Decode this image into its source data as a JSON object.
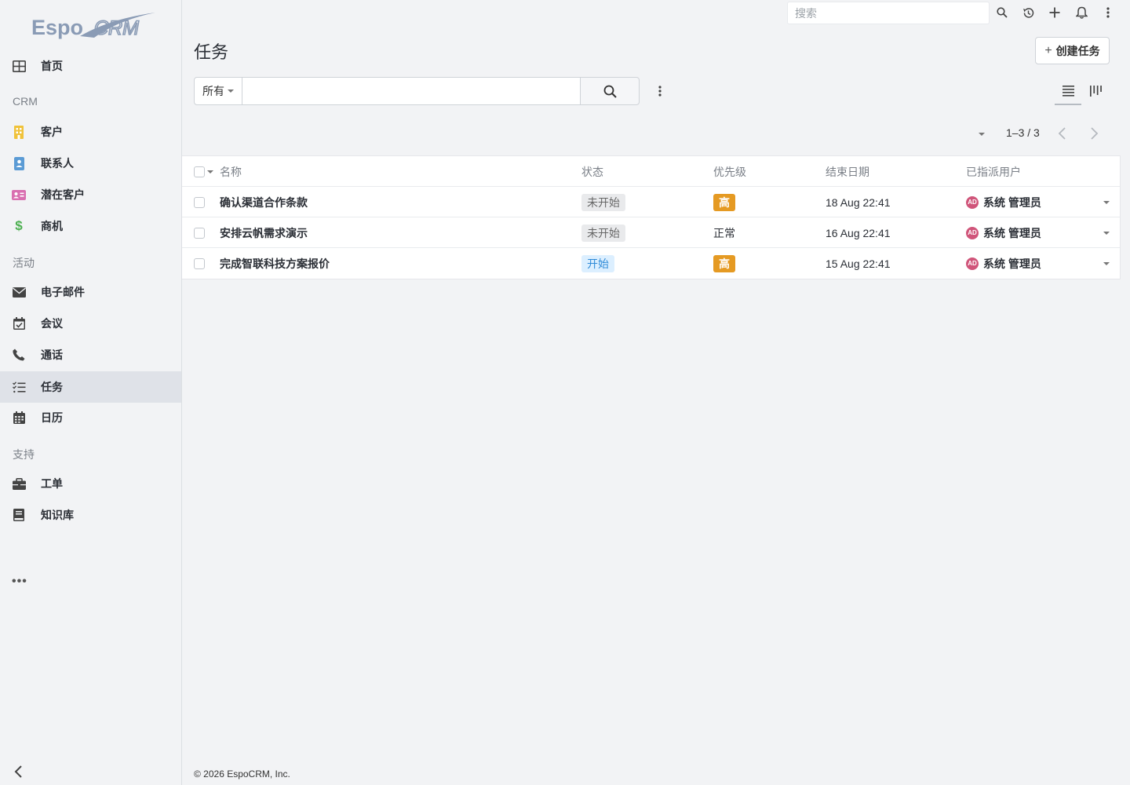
{
  "app": {
    "logo_text": "EspoCRM"
  },
  "sidebar": {
    "items": [
      {
        "label": "首页",
        "icon": "grid-icon"
      },
      {
        "group": "CRM"
      },
      {
        "label": "客户",
        "icon": "building-icon",
        "color": "#f0c23a"
      },
      {
        "label": "联系人",
        "icon": "contact-icon",
        "color": "#5b9bd5"
      },
      {
        "label": "潜在客户",
        "icon": "id-card-icon",
        "color": "#d96fb0"
      },
      {
        "label": "商机",
        "icon": "dollar-icon",
        "color": "#4caf50"
      },
      {
        "group": "活动"
      },
      {
        "label": "电子邮件",
        "icon": "envelope-icon"
      },
      {
        "label": "会议",
        "icon": "calendar-check-icon"
      },
      {
        "label": "通话",
        "icon": "phone-icon"
      },
      {
        "label": "任务",
        "icon": "tasks-icon",
        "active": true
      },
      {
        "label": "日历",
        "icon": "calendar-icon"
      },
      {
        "group": "支持"
      },
      {
        "label": "工单",
        "icon": "briefcase-icon"
      },
      {
        "label": "知识库",
        "icon": "book-icon"
      }
    ],
    "more": "•••"
  },
  "topbar": {
    "search_placeholder": "搜索"
  },
  "header": {
    "title": "任务",
    "create_label": "创建任务"
  },
  "search": {
    "filter_label": "所有",
    "value": ""
  },
  "pagination": {
    "count": "1–3 / 3"
  },
  "table": {
    "columns": [
      "名称",
      "状态",
      "优先级",
      "结束日期",
      "已指派用户"
    ],
    "rows": [
      {
        "name": "确认渠道合作条款",
        "status": "未开始",
        "status_style": "grey",
        "priority": "高",
        "priority_style": "warn",
        "due": "18 Aug 22:41",
        "avatar": "AD",
        "user": "系统 管理员"
      },
      {
        "name": "安排云帆需求演示",
        "status": "未开始",
        "status_style": "grey",
        "priority": "正常",
        "priority_style": "plain",
        "due": "16 Aug 22:41",
        "avatar": "AD",
        "user": "系统 管理员"
      },
      {
        "name": "完成智联科技方案报价",
        "status": "开始",
        "status_style": "info",
        "priority": "高",
        "priority_style": "warn",
        "due": "15 Aug 22:41",
        "avatar": "AD",
        "user": "系统 管理员"
      }
    ]
  },
  "footer": {
    "text": "© 2026 EspoCRM, Inc."
  }
}
